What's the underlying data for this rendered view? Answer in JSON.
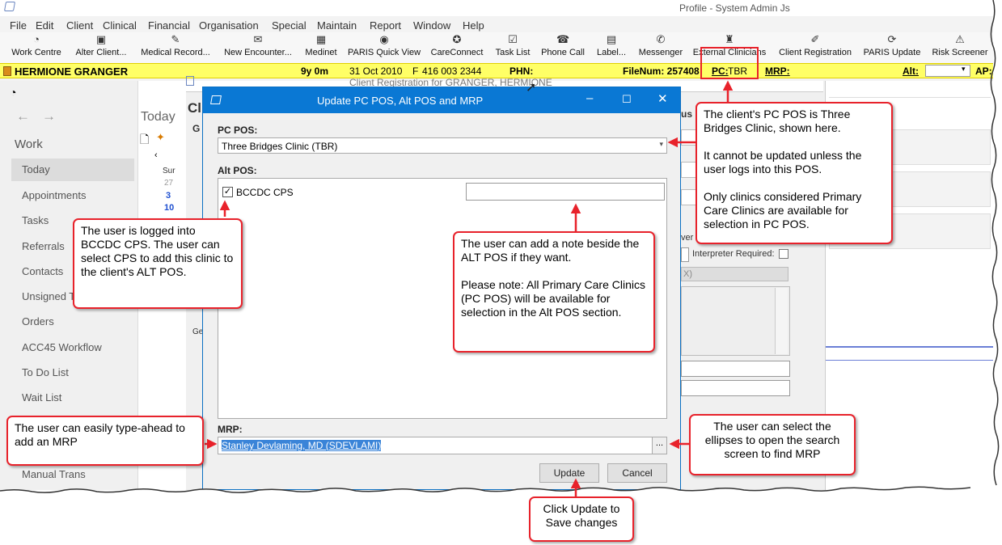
{
  "window": {
    "title": "Profile - System Admin Js"
  },
  "menu": [
    "File",
    "Edit",
    "Client",
    "Clinical",
    "Financial",
    "Organisation",
    "Special",
    "Maintain",
    "Report",
    "Window",
    "Help"
  ],
  "toolbar": [
    {
      "label": "Work Centre",
      "icon": "work-centre-icon",
      "glyph": "◔"
    },
    {
      "label": "Alter Client...",
      "icon": "alter-client-icon",
      "glyph": "▣"
    },
    {
      "label": "Medical Record...",
      "icon": "medical-record-icon",
      "glyph": "✎"
    },
    {
      "label": "New Encounter...",
      "icon": "new-encounter-icon",
      "glyph": "✉"
    },
    {
      "label": "Medinet",
      "icon": "medinet-icon",
      "glyph": "▦"
    },
    {
      "label": "PARIS Quick View",
      "icon": "quick-view-icon",
      "glyph": "◉"
    },
    {
      "label": "CareConnect",
      "icon": "careconnect-icon",
      "glyph": "✪"
    },
    {
      "label": "Task List",
      "icon": "task-list-icon",
      "glyph": "☑"
    },
    {
      "label": "Phone Call",
      "icon": "phone-icon",
      "glyph": "☎"
    },
    {
      "label": "Label...",
      "icon": "label-icon",
      "glyph": "▤"
    },
    {
      "label": "Messenger",
      "icon": "messenger-icon",
      "glyph": "✆"
    },
    {
      "label": "External Clinicians",
      "icon": "external-clinicians-icon",
      "glyph": "♜"
    },
    {
      "label": "Client Registration",
      "icon": "client-registration-icon",
      "glyph": "✐"
    },
    {
      "label": "PARIS Update",
      "icon": "paris-update-icon",
      "glyph": "⟳"
    },
    {
      "label": "Risk Screener",
      "icon": "risk-screener-icon",
      "glyph": "⚠"
    }
  ],
  "patient": {
    "name": "HERMIONE GRANGER",
    "age": "9y 0m",
    "dob": "31 Oct 2010",
    "sex": "F",
    "phone": "416 003 2344",
    "phn_label": "PHN:",
    "filenum": "FileNum: 257408",
    "pc_label": "PC:",
    "pc_value": "TBR",
    "mrp_label": "MRP:",
    "alt_label": "Alt:",
    "ap_label": "AP:"
  },
  "sidebar": {
    "today_header": "Today",
    "work_header": "Work",
    "items": [
      "Today",
      "Appointments",
      "Tasks",
      "Referrals",
      "Contacts",
      "Unsigned T",
      "Orders",
      "ACC45 Workflow",
      "To Do List",
      "Wait List",
      "Manual Trans"
    ]
  },
  "calendar": {
    "day": "Sur",
    "dates": [
      "27",
      "3",
      "10"
    ]
  },
  "background": {
    "client_reg_title": "Client Registration for GRANGER, HERMIONE",
    "cl_label": "Cl",
    "g_label": "G",
    "ge_label": "Ge",
    "interpreter_label": "Interpreter Required:",
    "tus_label": "tus",
    "ver_label": "ver",
    "x_label": "X)"
  },
  "dialog": {
    "title": "Update PC POS, Alt POS and MRP",
    "pc_pos_label": "PC POS:",
    "pc_pos_value": "Three Bridges Clinic (TBR)",
    "alt_pos_label": "Alt POS:",
    "alt_pos_item": "BCCDC CPS",
    "alt_pos_checked": true,
    "alt_pos_note": "",
    "mrp_label": "MRP:",
    "mrp_value": "Stanley Devlaming, MD (SDEVLAMI)",
    "ellipsis": "...",
    "update_button": "Update",
    "cancel_button": "Cancel"
  },
  "callouts": {
    "pc_pos": "The client's PC POS is Three Bridges Clinic, shown here.\n\nIt cannot be updated unless the user logs into this POS.\n\nOnly clinics considered Primary Care Clinics are available for selection in PC POS.",
    "logged_in": "The user is logged into BCCDC CPS.  The user can select CPS to add this clinic to the client's ALT POS.",
    "note": "The user can add a note beside the ALT POS if they want.\n\nPlease note:  All Primary Care Clinics (PC POS) will be available for selection in the Alt POS section.",
    "type_ahead": "The user can easily type-ahead to add an MRP",
    "ellipses": "The user can select the ellipses to open the search screen to find MRP",
    "update": "Click Update to Save changes"
  },
  "colors": {
    "callout_border": "#e8222b",
    "dialog_title": "#0a78d4",
    "patient_bar": "#ffff66",
    "link_blue": "#1e4fd0"
  }
}
